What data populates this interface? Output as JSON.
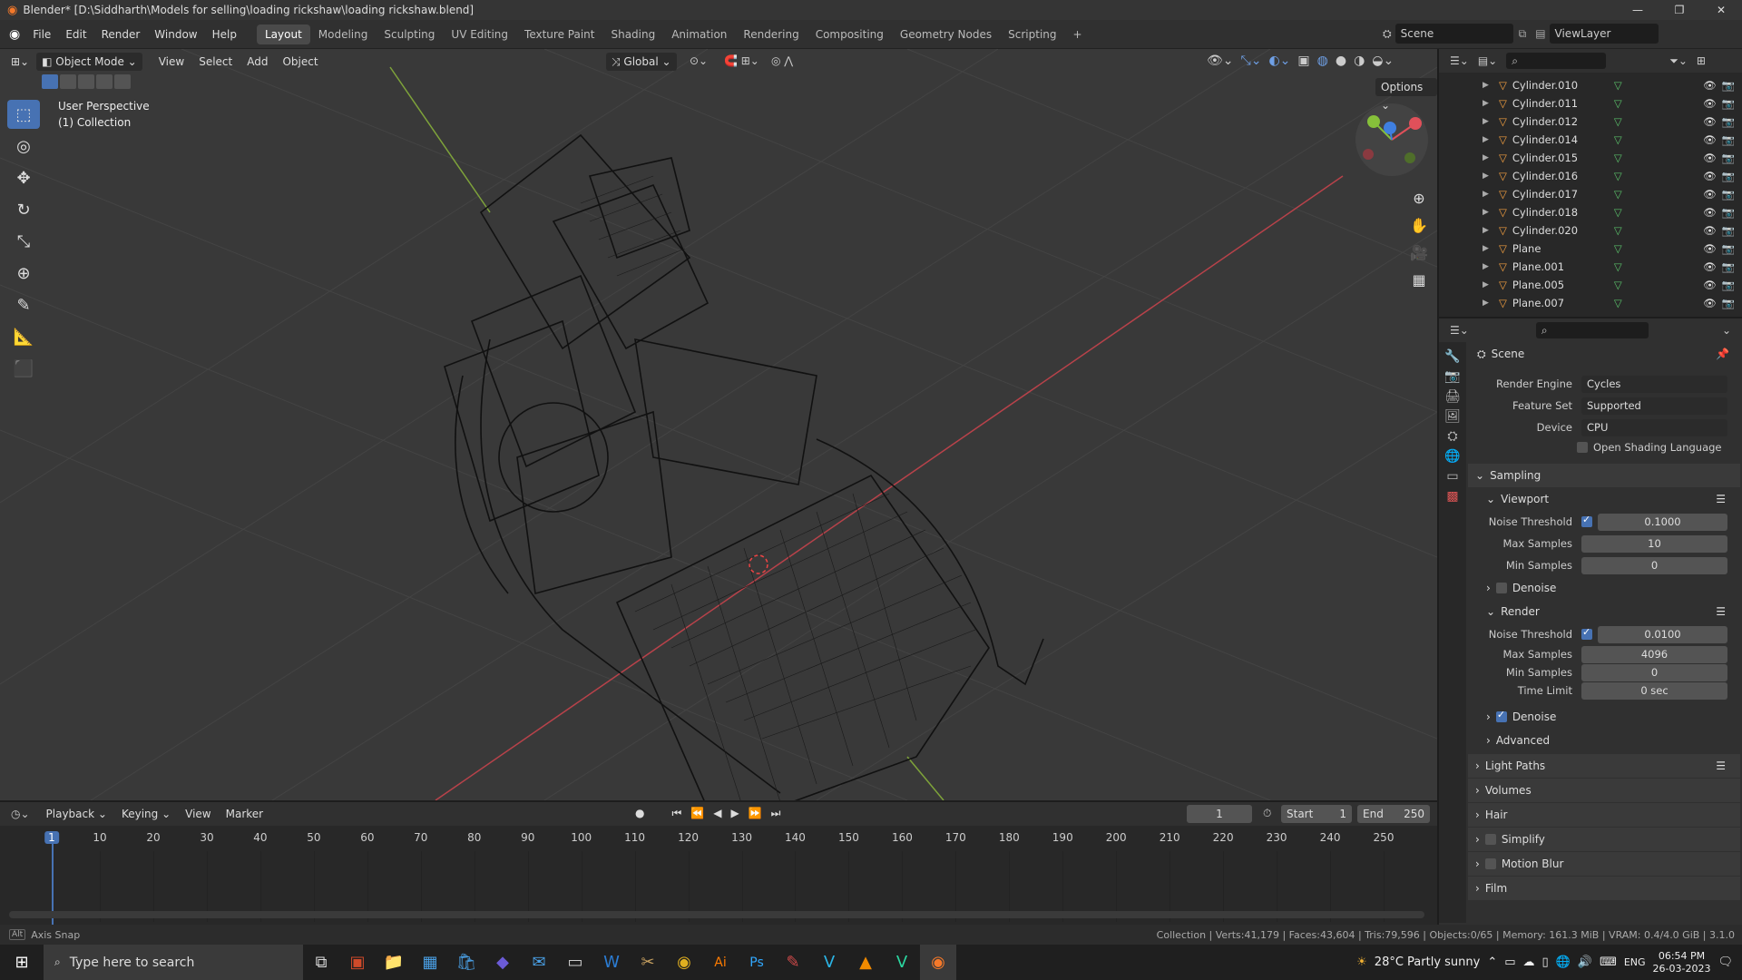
{
  "titlebar": {
    "title": "Blender* [D:\\Siddharth\\Models for selling\\loading rickshaw\\loading rickshaw.blend]",
    "min": "—",
    "max": "❐",
    "close": "✕"
  },
  "menu": {
    "items": [
      "File",
      "Edit",
      "Render",
      "Window",
      "Help"
    ],
    "workspaces": [
      "Layout",
      "Modeling",
      "Sculpting",
      "UV Editing",
      "Texture Paint",
      "Shading",
      "Animation",
      "Rendering",
      "Compositing",
      "Geometry Nodes",
      "Scripting",
      "+"
    ],
    "scene": "Scene",
    "view_layer": "ViewLayer"
  },
  "viewport": {
    "mode": "Object Mode",
    "menus": [
      "View",
      "Select",
      "Add",
      "Object"
    ],
    "orientation": "Global",
    "options": "Options",
    "overlay_title": "User Perspective",
    "overlay_collection": "(1) Collection",
    "gizmo": {
      "x": "X",
      "y": "Y",
      "z": "Z"
    }
  },
  "outliner": {
    "items": [
      "Cylinder.010",
      "Cylinder.011",
      "Cylinder.012",
      "Cylinder.014",
      "Cylinder.015",
      "Cylinder.016",
      "Cylinder.017",
      "Cylinder.018",
      "Cylinder.020",
      "Plane",
      "Plane.001",
      "Plane.005",
      "Plane.007"
    ]
  },
  "properties": {
    "context": "Scene",
    "render_engine_label": "Render Engine",
    "render_engine": "Cycles",
    "feature_set_label": "Feature Set",
    "feature_set": "Supported",
    "device_label": "Device",
    "device": "CPU",
    "osl_label": "Open Shading Language",
    "sampling": "Sampling",
    "viewport": "Viewport",
    "noise_threshold_label": "Noise Threshold",
    "vp_noise": "0.1000",
    "max_samples_label": "Max Samples",
    "vp_max": "10",
    "min_samples_label": "Min Samples",
    "vp_min": "0",
    "denoise": "Denoise",
    "render": "Render",
    "r_noise": "0.0100",
    "r_max": "4096",
    "r_min": "0",
    "time_limit_label": "Time Limit",
    "r_time": "0 sec",
    "advanced": "Advanced",
    "panels": [
      "Light Paths",
      "Volumes",
      "Hair",
      "Simplify",
      "Motion Blur",
      "Film"
    ]
  },
  "timeline": {
    "menus": [
      "Playback",
      "Keying",
      "View",
      "Marker"
    ],
    "current_frame": "1",
    "start_label": "Start",
    "start": "1",
    "end_label": "End",
    "end": "250",
    "ticks": [
      "1",
      "10",
      "20",
      "30",
      "40",
      "50",
      "60",
      "70",
      "80",
      "90",
      "100",
      "110",
      "120",
      "130",
      "140",
      "150",
      "160",
      "170",
      "180",
      "190",
      "200",
      "210",
      "220",
      "230",
      "240",
      "250"
    ]
  },
  "status": {
    "left_key": "Alt",
    "left": "Axis Snap",
    "right": "Collection | Verts:41,179 | Faces:43,604 | Tris:79,596 | Objects:0/65 | Memory: 161.3 MiB | VRAM: 0.4/4.0 GiB | 3.1.0"
  },
  "taskbar": {
    "search_placeholder": "Type here to search",
    "weather": "28°C  Partly sunny",
    "lang": "ENG",
    "time": "06:54 PM",
    "date": "26-03-2023"
  },
  "colors": {
    "accent": "#4772b3",
    "x_axis": "#e0505a",
    "y_axis": "#86c03a",
    "z_axis": "#3f7fe0"
  }
}
